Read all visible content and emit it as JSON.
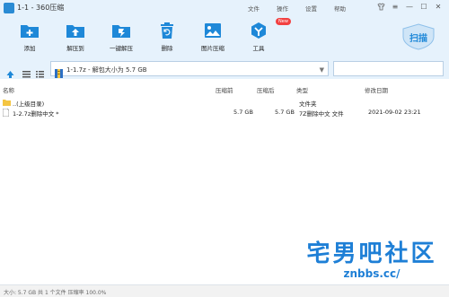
{
  "window": {
    "title": "1-1 - 360压缩",
    "min": "—",
    "max": "☐",
    "close": "✕"
  },
  "menu": {
    "file": "文件",
    "operate": "操作",
    "settings": "设置",
    "help": "帮助"
  },
  "toolbar": {
    "add": "添加",
    "extract_to": "解压到",
    "one_click_extract": "一键解压",
    "delete": "删除",
    "image_compress": "图片压缩",
    "tools": "工具",
    "new_badge": "New",
    "scan": "扫描"
  },
  "address": {
    "path": "1-1.7z - 解包大小为 5.7 GB",
    "dropdown": "▼",
    "search_placeholder": ""
  },
  "columns": {
    "name": "名称",
    "compressed": "压缩前",
    "size": "压缩后",
    "type": "类型",
    "modified": "修改日期"
  },
  "rows": [
    {
      "name": "..(上级目录)",
      "compressed": "",
      "size": "",
      "type": "文件夹",
      "modified": ""
    },
    {
      "name": "1-2.7z删除中文 *",
      "compressed": "5.7 GB",
      "size": "5.7 GB",
      "type": "7Z删除中文 文件",
      "modified": "2021-09-02 23:21"
    }
  ],
  "status": {
    "text": "大小: 5.7 GB 共 1 个文件 压缩率 100.0%"
  },
  "watermark": {
    "line1": "宅男吧社区",
    "line2": "znbbs.cc/"
  },
  "colors": {
    "accent": "#1e88d8",
    "toolbar_bg": "#e6f2fc",
    "badge": "#f24141"
  }
}
